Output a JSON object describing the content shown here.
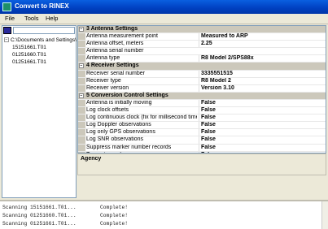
{
  "window": {
    "title": "Convert to RINEX"
  },
  "menu": [
    "File",
    "Tools",
    "Help"
  ],
  "tree": {
    "root": "C:\\Documents and Settings\\",
    "files": [
      "15151661.T01",
      "01251660.T01",
      "01251661.T01"
    ]
  },
  "properties": [
    {
      "category": "3 Antenna Settings",
      "items": [
        {
          "name": "Antenna measurement point",
          "value": "Measured to ARP"
        },
        {
          "name": "Antenna offset, meters",
          "value": "2.25"
        },
        {
          "name": "Antenna serial number",
          "value": ""
        },
        {
          "name": "Antenna type",
          "value": "R8 Model 2/SPS88x"
        }
      ]
    },
    {
      "category": "4 Receiver Settings",
      "items": [
        {
          "name": "Receiver serial number",
          "value": "3335551515"
        },
        {
          "name": "Receiver type",
          "value": "R8 Model 2"
        },
        {
          "name": "Receiver version",
          "value": "Version 3.10"
        }
      ]
    },
    {
      "category": "5 Conversion Control Settings",
      "items": [
        {
          "name": "Antenna is initially moving",
          "value": "False"
        },
        {
          "name": "Log clock offsets",
          "value": "False"
        },
        {
          "name": "Log continuous clock (fix for millisecond time jumps)",
          "value": "False"
        },
        {
          "name": "Log Doppler observations",
          "value": "False"
        },
        {
          "name": "Log only GPS observations",
          "value": "False"
        },
        {
          "name": "Log SNR observations",
          "value": "False"
        },
        {
          "name": "Suppress marker number records",
          "value": "False"
        },
        {
          "name": "Truncate marker names",
          "value": "False"
        }
      ]
    }
  ],
  "description": {
    "label": "Agency"
  },
  "log": [
    {
      "text": "Scanning 15151661.T01...",
      "status": "Complete!"
    },
    {
      "text": "Scanning 01251660.T01...",
      "status": "Complete!"
    },
    {
      "text": "Scanning 01251661.T01...",
      "status": "Complete!"
    }
  ]
}
